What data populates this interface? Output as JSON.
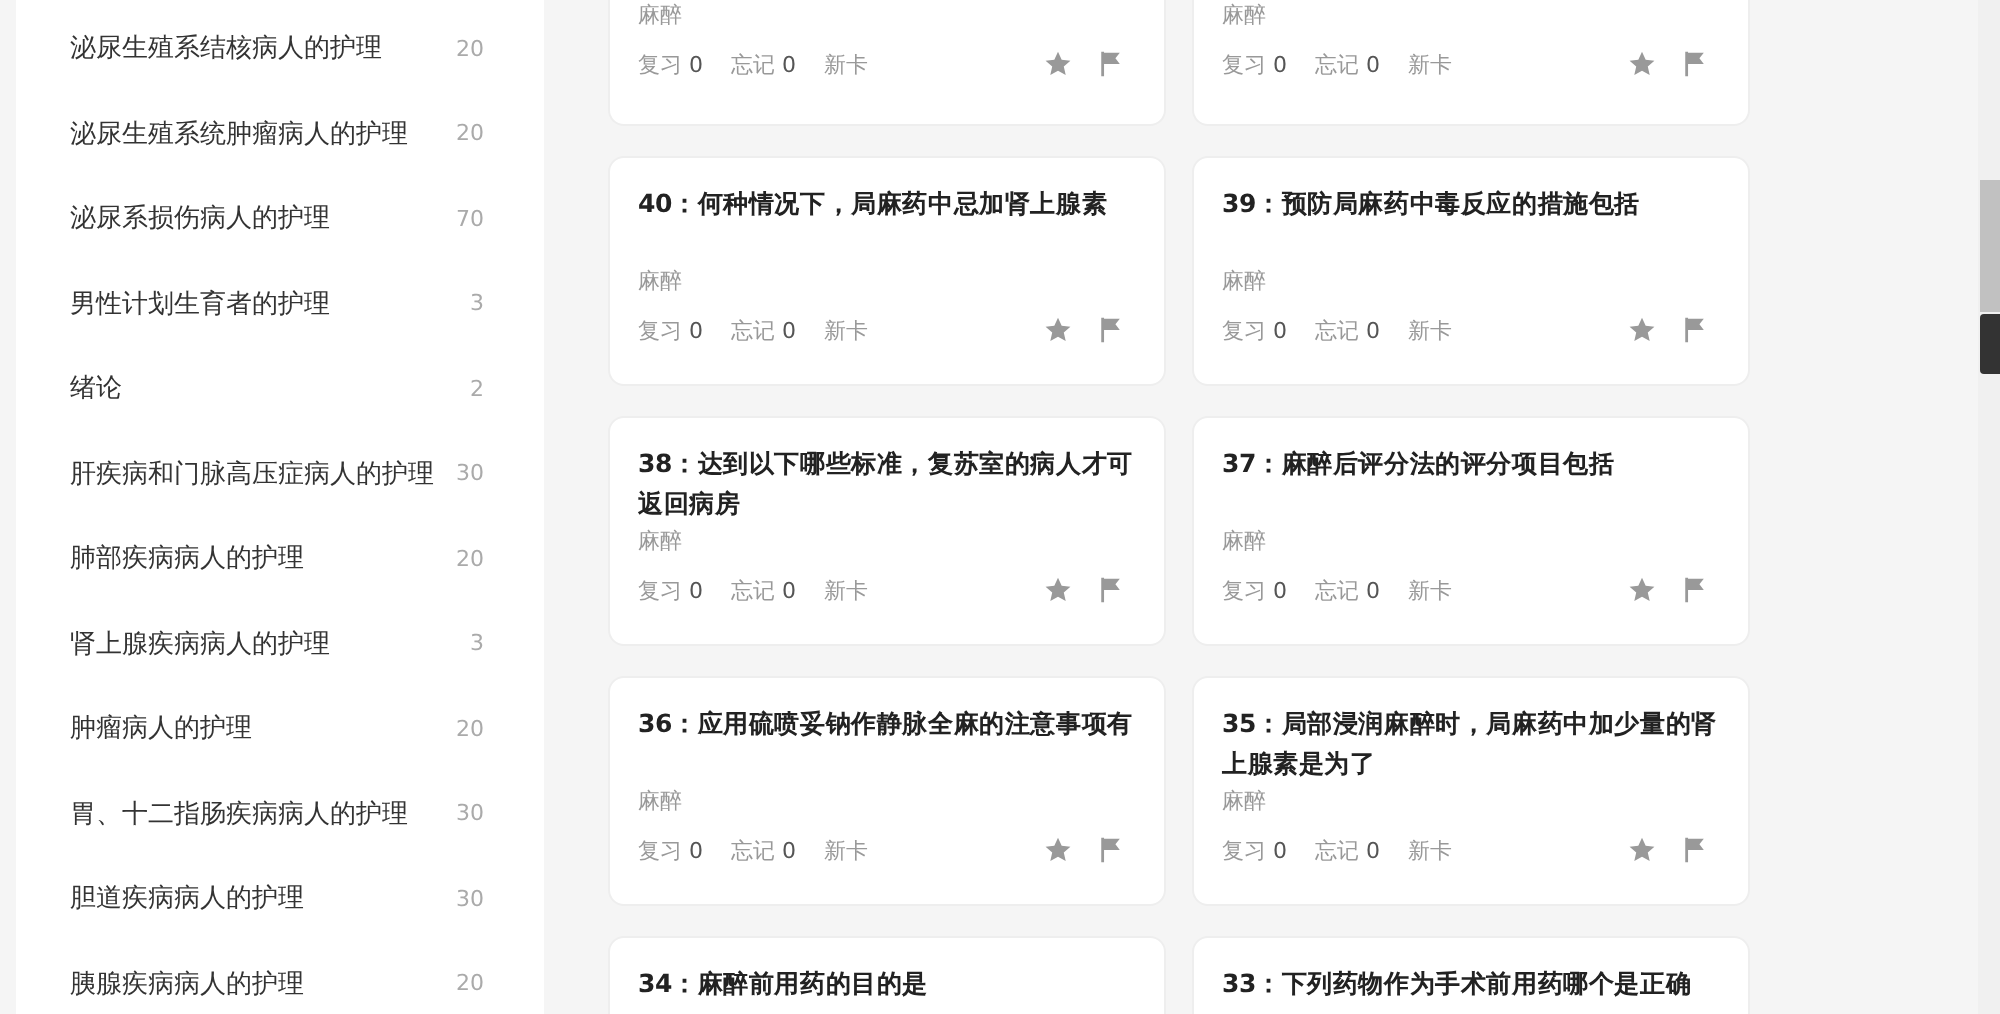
{
  "sidebar": {
    "items": [
      {
        "label": "泌尿生殖系结核病人的护理",
        "count": "20"
      },
      {
        "label": "泌尿生殖系统肿瘤病人的护理",
        "count": "20"
      },
      {
        "label": "泌尿系损伤病人的护理",
        "count": "70"
      },
      {
        "label": "男性计划生育者的护理",
        "count": "3"
      },
      {
        "label": "绪论",
        "count": "2"
      },
      {
        "label": "肝疾病和门脉高压症病人的护理",
        "count": "30"
      },
      {
        "label": "肺部疾病病人的护理",
        "count": "20"
      },
      {
        "label": "肾上腺疾病病人的护理",
        "count": "3"
      },
      {
        "label": "肿瘤病人的护理",
        "count": "20"
      },
      {
        "label": "胃、十二指肠疾病病人的护理",
        "count": "30"
      },
      {
        "label": "胆道疾病病人的护理",
        "count": "30"
      },
      {
        "label": "胰腺疾病病人的护理",
        "count": "20"
      }
    ]
  },
  "cards": [
    {
      "tag": "麻醉",
      "stats": [
        {
          "label": "复习",
          "value": "0"
        },
        {
          "label": "忘记",
          "value": "0"
        }
      ],
      "status": "新卡"
    },
    {
      "tag": "麻醉",
      "stats": [
        {
          "label": "复习",
          "value": "0"
        },
        {
          "label": "忘记",
          "value": "0"
        }
      ],
      "status": "新卡"
    },
    {
      "title": "40：何种情况下，局麻药中忌加肾上腺素",
      "tag": "麻醉",
      "stats": [
        {
          "label": "复习",
          "value": "0"
        },
        {
          "label": "忘记",
          "value": "0"
        }
      ],
      "status": "新卡"
    },
    {
      "title": "39：预防局麻药中毒反应的措施包括",
      "tag": "麻醉",
      "stats": [
        {
          "label": "复习",
          "value": "0"
        },
        {
          "label": "忘记",
          "value": "0"
        }
      ],
      "status": "新卡"
    },
    {
      "title": "38：达到以下哪些标准，复苏室的病人才可返回病房",
      "tag": "麻醉",
      "stats": [
        {
          "label": "复习",
          "value": "0"
        },
        {
          "label": "忘记",
          "value": "0"
        }
      ],
      "status": "新卡"
    },
    {
      "title": "37：麻醉后评分法的评分项目包括",
      "tag": "麻醉",
      "stats": [
        {
          "label": "复习",
          "value": "0"
        },
        {
          "label": "忘记",
          "value": "0"
        }
      ],
      "status": "新卡"
    },
    {
      "title": "36：应用硫喷妥钠作静脉全麻的注意事项有",
      "tag": "麻醉",
      "stats": [
        {
          "label": "复习",
          "value": "0"
        },
        {
          "label": "忘记",
          "value": "0"
        }
      ],
      "status": "新卡"
    },
    {
      "title": "35：局部浸润麻醉时，局麻药中加少量的肾上腺素是为了",
      "tag": "麻醉",
      "stats": [
        {
          "label": "复习",
          "value": "0"
        },
        {
          "label": "忘记",
          "value": "0"
        }
      ],
      "status": "新卡"
    },
    {
      "title": "34：麻醉前用药的目的是"
    },
    {
      "title": "33：下列药物作为手术前用药哪个是正确"
    }
  ]
}
